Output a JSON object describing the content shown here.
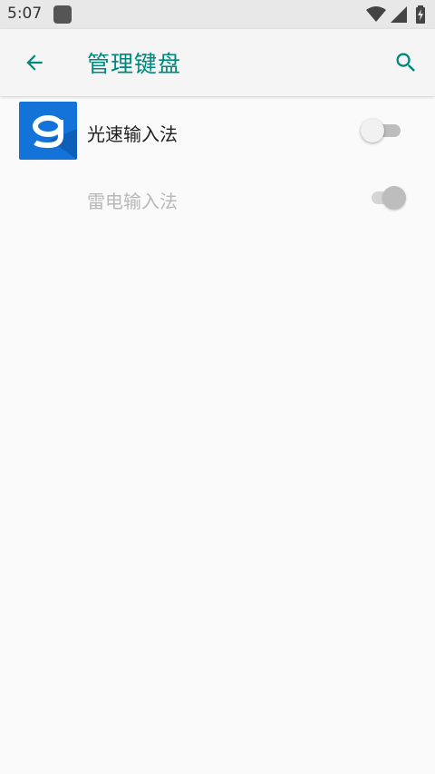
{
  "status_bar": {
    "time": "5:07",
    "icons": [
      "app-notification-icon",
      "wifi-icon",
      "signal-icon",
      "battery-charging-icon"
    ]
  },
  "toolbar": {
    "title": "管理键盘",
    "back_icon": "arrow-back-icon",
    "search_icon": "search-icon"
  },
  "keyboards": [
    {
      "label": "光速输入法",
      "enabled": false,
      "disabled": false,
      "icon": "g-keyboard-app-icon"
    },
    {
      "label": "雷电输入法",
      "enabled": true,
      "disabled": true
    }
  ],
  "colors": {
    "accent": "#00897b",
    "app_icon_bg": "#1473d8",
    "background": "#fafafa"
  }
}
